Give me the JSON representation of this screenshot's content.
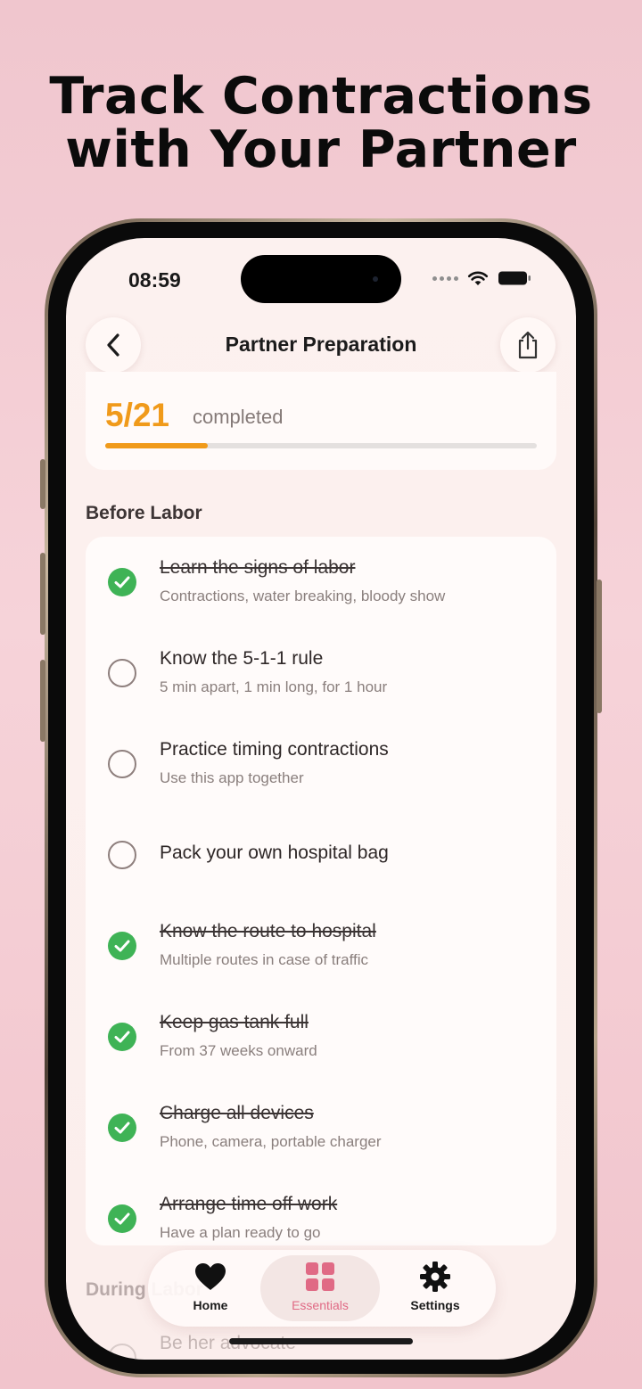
{
  "headline": {
    "line1": "Track Contractions",
    "line2": "with Your Partner"
  },
  "status_bar": {
    "time": "08:59"
  },
  "nav": {
    "title": "Partner Preparation",
    "back_icon": "chevron-left-icon",
    "share_icon": "share-icon"
  },
  "progress": {
    "count": "5/21",
    "label": "completed",
    "fraction": 0.238,
    "color": "#f09a1b"
  },
  "sections": [
    {
      "title": "Before Labor",
      "items": [
        {
          "title": "Learn the signs of labor",
          "subtitle": "Contractions, water breaking, bloody show",
          "done": true
        },
        {
          "title": "Know the 5-1-1 rule",
          "subtitle": "5 min apart, 1 min long, for 1 hour",
          "done": false
        },
        {
          "title": "Practice timing contractions",
          "subtitle": "Use this app together",
          "done": false
        },
        {
          "title": "Pack your own hospital bag",
          "subtitle": "",
          "done": false
        },
        {
          "title": "Know the route to hospital",
          "subtitle": "Multiple routes in case of traffic",
          "done": true
        },
        {
          "title": "Keep gas tank full",
          "subtitle": "From 37 weeks onward",
          "done": true
        },
        {
          "title": "Charge all devices",
          "subtitle": "Phone, camera, portable charger",
          "done": true
        },
        {
          "title": "Arrange time off work",
          "subtitle": "Have a plan ready to go",
          "done": true
        }
      ]
    },
    {
      "title": "During Labor",
      "items": [
        {
          "title": "Be her advocate"
        }
      ]
    }
  ],
  "tabbar": {
    "tabs": [
      {
        "label": "Home",
        "icon": "heart-icon"
      },
      {
        "label": "Essentials",
        "icon": "grid-icon",
        "active": true
      },
      {
        "label": "Settings",
        "icon": "gear-icon"
      }
    ],
    "active_color": "#e06a85"
  }
}
